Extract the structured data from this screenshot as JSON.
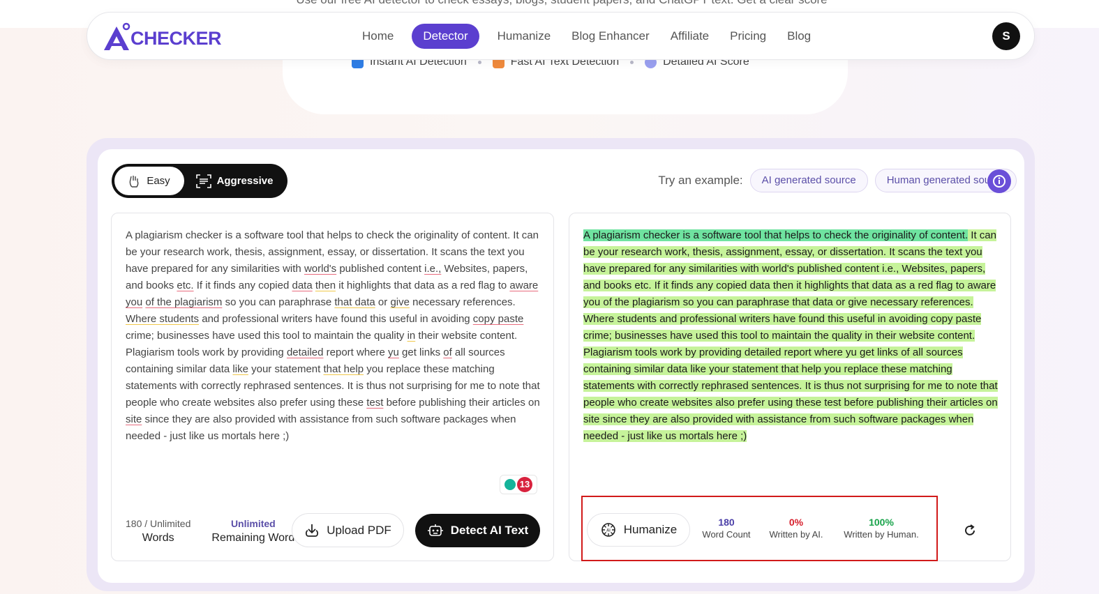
{
  "hero": {
    "subtitle": "Use our free AI detector to check essays, blogs, student papers, and ChatGPT text. Get a clear score",
    "features": [
      "Instant AI Detection",
      "Fast AI Text Detection",
      "Detailed AI Score"
    ]
  },
  "nav": {
    "logo_text": "CHECKER",
    "logo_mark": "A",
    "links": [
      "Home",
      "Detector",
      "Humanize",
      "Blog Enhancer",
      "Affiliate",
      "Pricing",
      "Blog"
    ],
    "active": "Detector",
    "avatar_initial": "S"
  },
  "mode": {
    "easy": "Easy",
    "aggressive": "Aggressive",
    "selected": "Easy"
  },
  "examples": {
    "label": "Try an example:",
    "ai": "AI generated source",
    "human": "Human generated source"
  },
  "input": {
    "segments": [
      {
        "t": "A plagiarism checker is a software tool that helps to check the originality of content. It can be your research work, thesis, assignment, essay, or dissertation. It scans the text you have prepared for any similarities with "
      },
      {
        "t": "world's",
        "u": "red"
      },
      {
        "t": " published content "
      },
      {
        "t": "i.e.,",
        "u": "red"
      },
      {
        "t": " Websites, papers, and books "
      },
      {
        "t": "etc.",
        "u": "red"
      },
      {
        "t": " If it finds any copied "
      },
      {
        "t": "data",
        "u": "red"
      },
      {
        "t": " "
      },
      {
        "t": "then",
        "u": "yel"
      },
      {
        "t": " it highlights that data as a red flag to "
      },
      {
        "t": "aware you",
        "u": "red"
      },
      {
        "t": " "
      },
      {
        "t": "of the plagiarism",
        "u": "red"
      },
      {
        "t": " so you can paraphrase "
      },
      {
        "t": "that data",
        "u": "yel"
      },
      {
        "t": " or "
      },
      {
        "t": "give",
        "u": "yel"
      },
      {
        "t": " necessary references. "
      },
      {
        "t": "Where students",
        "u": "yel"
      },
      {
        "t": " and professional writers have found this useful in avoiding "
      },
      {
        "t": "copy paste",
        "u": "red"
      },
      {
        "t": " crime; businesses have used this tool to maintain the quality "
      },
      {
        "t": "in",
        "u": "yel"
      },
      {
        "t": " their website content. Plagiarism tools work by providing "
      },
      {
        "t": "detailed",
        "u": "red"
      },
      {
        "t": " report where "
      },
      {
        "t": "yu",
        "u": "red"
      },
      {
        "t": " get links "
      },
      {
        "t": "of",
        "u": "red"
      },
      {
        "t": " all sources containing similar data "
      },
      {
        "t": "like",
        "u": "yel"
      },
      {
        "t": " your statement "
      },
      {
        "t": "that help",
        "u": "yel"
      },
      {
        "t": " you replace these matching statements with correctly rephrased sentences. It is thus not surprising for me to note that people who create websites also prefer using these "
      },
      {
        "t": "test",
        "u": "red"
      },
      {
        "t": " before publishing their articles on "
      },
      {
        "t": "site",
        "u": "red"
      },
      {
        "t": " since they are also provided with assistance from such software packages when needed - just like us mortals here ;)"
      }
    ],
    "issues_count": "13",
    "words_value": "180 / Unlimited",
    "words_label": "Words",
    "remaining_value": "Unlimited",
    "remaining_label": "Remaining Word",
    "upload_label": "Upload PDF",
    "detect_label": "Detect AI Text"
  },
  "result": {
    "segments": [
      {
        "t": "A plagiarism checker is a software tool that helps to check the originality of content.",
        "h": "strong"
      },
      {
        "t": " It can be your research work, thesis, assignment, essay, or dissertation. It scans the text you have prepared for any similarities with world's published content i.e., Websites, papers, and books etc.",
        "h": "light"
      },
      {
        "t": " If it finds any copied data then it highlights that data as a red flag to aware you of the plagiarism so you can paraphrase that data or give necessary references.",
        "h": "light"
      },
      {
        "t": " Where students and professional writers have found this useful in avoiding copy paste crime; businesses have used this tool to maintain the quality in their website content.",
        "h": "light"
      },
      {
        "t": " Plagiarism tools work by providing detailed report where yu get links of all sources containing similar data like your statement that help you replace these matching statements with correctly rephrased sentences.",
        "h": "light"
      },
      {
        "t": " It is thus not surprising for me to note that people who create websites also prefer using these test before publishing their articles on site since they are also provided with assistance from such software packages when needed - just like us mortals here ;)",
        "h": "light"
      }
    ],
    "humanize_label": "Humanize",
    "word_count_value": "180",
    "word_count_label": "Word Count",
    "ai_value": "0%",
    "ai_label": "Written by AI.",
    "human_value": "100%",
    "human_label": "Written by Human.",
    "colors": {
      "words": "#4b3fa8",
      "ai": "#d61f2c",
      "human": "#18a34a",
      "highlight_strong": "#6fe3a0",
      "highlight_light": "#c6f39a"
    }
  }
}
